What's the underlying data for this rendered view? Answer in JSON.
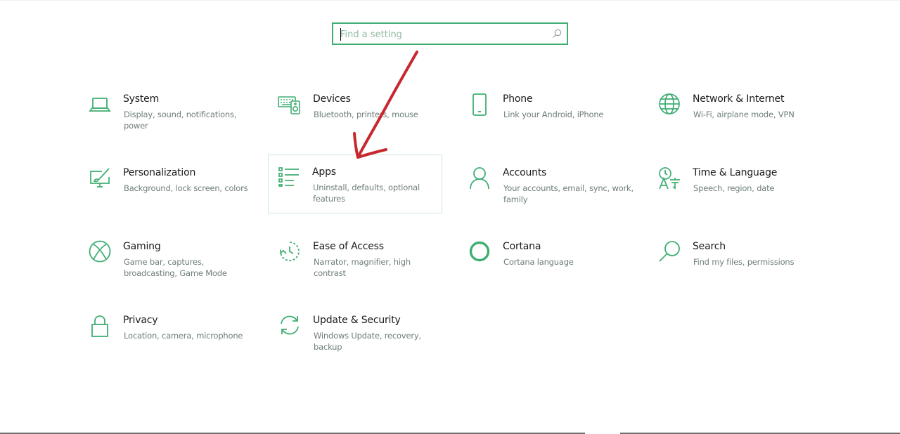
{
  "search": {
    "placeholder": "Find a setting",
    "value": ""
  },
  "accent_color": "#3fae72",
  "annotation_color": "#c8282d",
  "tiles": [
    {
      "title": "System",
      "desc": "Display, sound, notifications, power",
      "icon": "laptop-icon"
    },
    {
      "title": "Devices",
      "desc": "Bluetooth, printers, mouse",
      "icon": "keyboard-speaker-icon"
    },
    {
      "title": "Phone",
      "desc": "Link your Android, iPhone",
      "icon": "phone-icon"
    },
    {
      "title": "Network & Internet",
      "desc": "Wi-Fi, airplane mode, VPN",
      "icon": "globe-icon"
    },
    {
      "title": "Personalization",
      "desc": "Background, lock screen, colors",
      "icon": "paintbrush-monitor-icon"
    },
    {
      "title": "Apps",
      "desc": "Uninstall, defaults, optional features",
      "icon": "apps-list-icon"
    },
    {
      "title": "Accounts",
      "desc": "Your accounts, email, sync, work, family",
      "icon": "person-icon"
    },
    {
      "title": "Time & Language",
      "desc": "Speech, region, date",
      "icon": "time-language-icon"
    },
    {
      "title": "Gaming",
      "desc": "Game bar, captures, broadcasting, Game Mode",
      "icon": "xbox-icon"
    },
    {
      "title": "Ease of Access",
      "desc": "Narrator, magnifier, high contrast",
      "icon": "ease-of-access-icon"
    },
    {
      "title": "Cortana",
      "desc": "Cortana language",
      "icon": "cortana-circle-icon"
    },
    {
      "title": "Search",
      "desc": "Find my files, permissions",
      "icon": "magnifier-icon"
    },
    {
      "title": "Privacy",
      "desc": "Location, camera, microphone",
      "icon": "padlock-icon"
    },
    {
      "title": "Update & Security",
      "desc": "Windows Update, recovery, backup",
      "icon": "sync-arrows-icon"
    }
  ]
}
